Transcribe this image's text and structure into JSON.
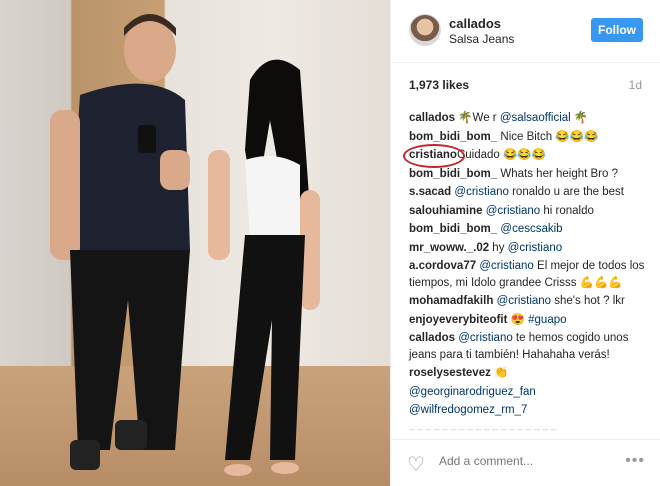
{
  "post": {
    "username": "callados",
    "location": "Salsa Jeans",
    "follow_label": "Follow",
    "likes": "1,973 likes",
    "time": "1d"
  },
  "comments": [
    {
      "user": "callados",
      "parts": [
        " 🌴We r ",
        {
          "mention": "@salsaofficial"
        },
        " 🌴"
      ]
    },
    {
      "user": "bom_bidi_bom_",
      "parts": [
        " Nice Bitch 😂😂😂"
      ]
    },
    {
      "user": "cristiano",
      "parts": [
        "Cuidado 😂😂😂"
      ],
      "highlight": true
    },
    {
      "user": "bom_bidi_bom_",
      "parts": [
        " Whats her height Bro ?"
      ]
    },
    {
      "user": "s.sacad",
      "parts": [
        " ",
        {
          "mention": "@cristiano"
        },
        " ronaldo u are the best"
      ]
    },
    {
      "user": "salouhiamine",
      "parts": [
        " ",
        {
          "mention": "@cristiano"
        },
        " hi ronaldo"
      ]
    },
    {
      "user": "bom_bidi_bom_",
      "parts": [
        " ",
        {
          "mention": "@cescsakib"
        }
      ]
    },
    {
      "user": "mr_woww._.02",
      "parts": [
        " hy ",
        {
          "mention": "@cristiano"
        }
      ]
    },
    {
      "user": "a.cordova77",
      "parts": [
        " ",
        {
          "mention": "@cristiano"
        },
        " El mejor de todos los tiempos, mi Idolo grandee Crisss 💪💪💪"
      ]
    },
    {
      "user": "mohamadfakilh",
      "parts": [
        " ",
        {
          "mention": "@cristiano"
        },
        " she's hot ? lkr"
      ]
    },
    {
      "user": "enjoyeverybiteofit",
      "parts": [
        " 😍 ",
        {
          "mention": "#guapo"
        }
      ]
    },
    {
      "user": "callados",
      "parts": [
        " ",
        {
          "mention": "@cristiano"
        },
        " te hemos cogido unos jeans para ti también! Hahahaha verás!"
      ]
    },
    {
      "user": "roselysestevez",
      "parts": [
        " 👏"
      ]
    },
    {
      "user": "",
      "parts": [
        {
          "mention": "@georginarodriguez_fan"
        }
      ]
    },
    {
      "user": "",
      "parts": [
        {
          "mention": "@wilfredogomez_rm_7"
        }
      ]
    }
  ],
  "cut_line": "_ _ _ _ _ _ _ _ _ _ _ _ _ _ _ _ _ _",
  "add_comment_placeholder": "Add a comment...",
  "icons": {
    "like": "heart-icon",
    "more": "more-options-icon"
  }
}
